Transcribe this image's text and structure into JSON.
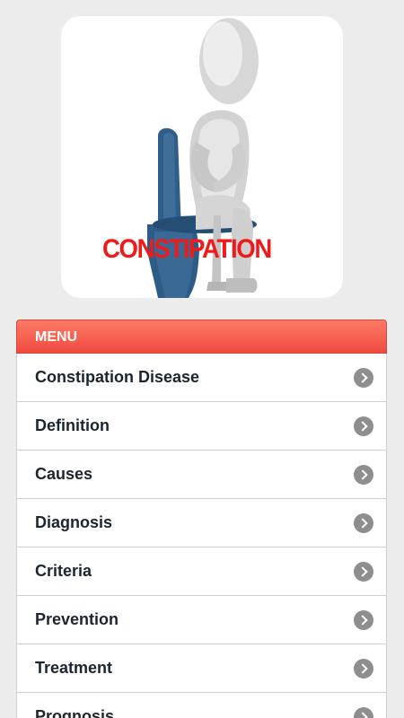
{
  "hero": {
    "caption": "CONSTIPATION",
    "image_name": "constipation-figure-illustration"
  },
  "menu": {
    "header": "MENU",
    "items": [
      {
        "label": "Constipation Disease"
      },
      {
        "label": "Definition"
      },
      {
        "label": "Causes"
      },
      {
        "label": "Diagnosis"
      },
      {
        "label": "Criteria"
      },
      {
        "label": "Prevention"
      },
      {
        "label": "Treatment"
      },
      {
        "label": "Prognosis"
      }
    ]
  },
  "colors": {
    "header_red": "#ef4b3f",
    "caption_red": "#ef1b1b",
    "arrow_grey": "#8e8e8e",
    "toilet_blue": "#2d5f8a"
  }
}
